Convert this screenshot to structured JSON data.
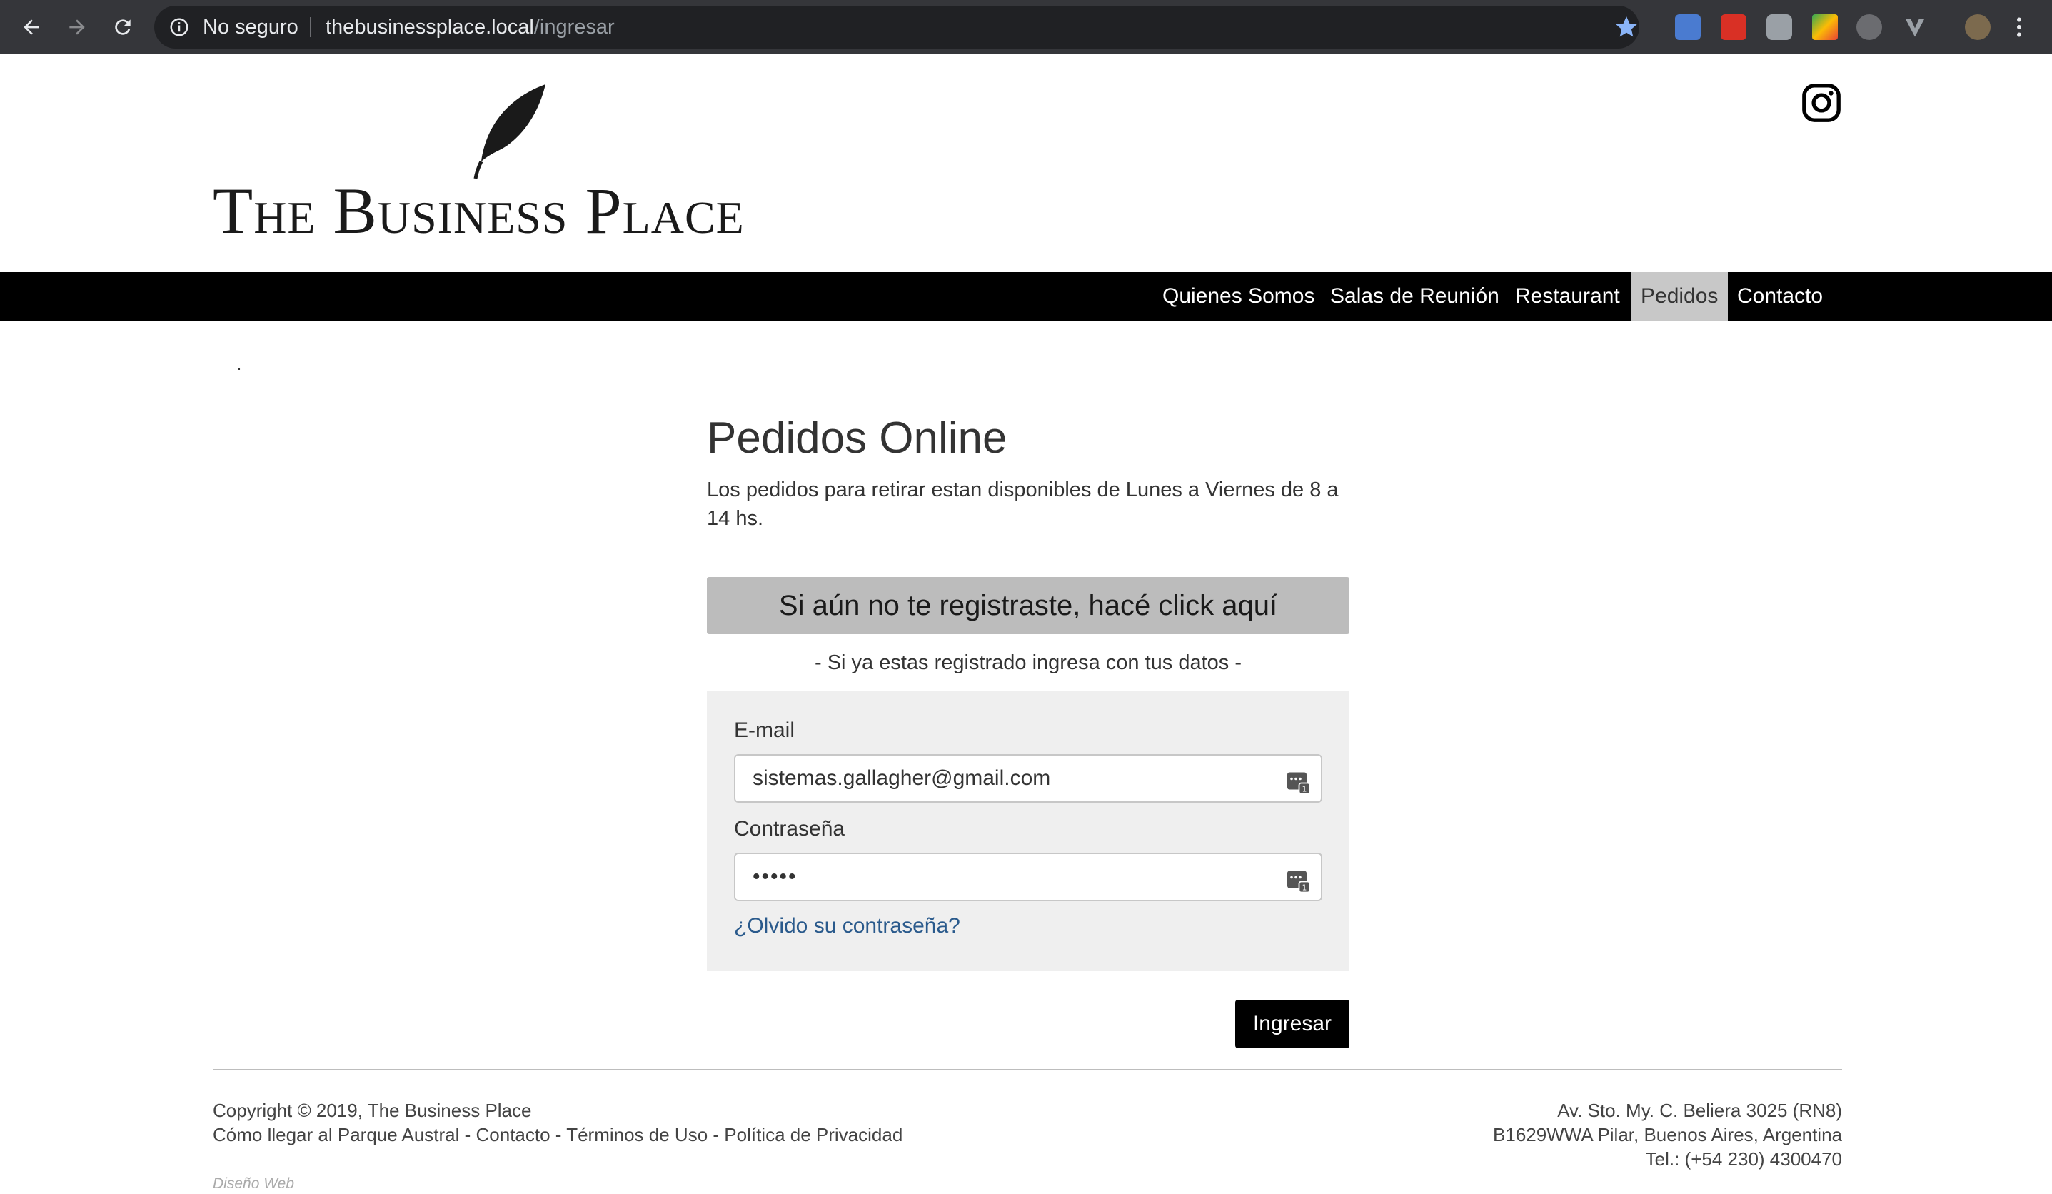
{
  "browser": {
    "security_label": "No seguro",
    "url_host": "thebusinessplace.local",
    "url_path": "/ingresar",
    "icons": [
      "back-icon",
      "forward-icon",
      "reload-icon",
      "info-icon",
      "star-icon",
      "extension-icon",
      "menu-icon"
    ]
  },
  "header": {
    "logo_text": "The Business Place"
  },
  "nav": {
    "items": [
      {
        "label": "Quienes Somos"
      },
      {
        "label": "Salas de Reunión"
      },
      {
        "label": "Restaurant"
      },
      {
        "label": "Pedidos",
        "active": true
      },
      {
        "label": "Contacto"
      }
    ]
  },
  "main": {
    "dot": ".",
    "title": "Pedidos Online",
    "description": "Los pedidos para retirar estan disponibles de Lunes a Viernes de 8 a 14 hs.",
    "register_label": "Si aún no te registraste, hacé click aquí",
    "registered_note": "- Si ya estas registrado ingresa con tus datos -",
    "form": {
      "email_label": "E-mail",
      "email_value": "sistemas.gallagher@gmail.com",
      "password_label": "Contraseña",
      "password_value": "•••••",
      "forgot_label": "¿Olvido su contraseña?"
    },
    "submit_label": "Ingresar"
  },
  "footer": {
    "copyright": "Copyright © 2019, The Business Place",
    "links": "Cómo llegar al Parque Austral - Contacto - Términos de Uso - Política de Privacidad",
    "address_line1": "Av. Sto. My. C. Beliera 3025 (RN8)",
    "address_line2": "B1629WWA Pilar, Buenos Aires, Argentina",
    "phone": "Tel.: (+54 230) 4300470",
    "credit": "Diseño Web"
  },
  "colors": {
    "chrome_bg": "#35363a",
    "navbar_bg": "#000000",
    "nav_active_bg": "#c8c8c8",
    "register_btn_bg": "#bcbcbc",
    "form_bg": "#efefef",
    "link": "#2a5a8c"
  }
}
